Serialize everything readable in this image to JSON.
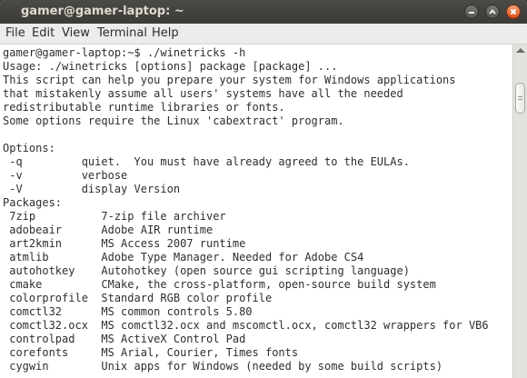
{
  "window": {
    "title": "gamer@gamer-laptop: ~"
  },
  "menu": [
    {
      "label": "File"
    },
    {
      "label": "Edit"
    },
    {
      "label": "View"
    },
    {
      "label": "Terminal"
    },
    {
      "label": "Help"
    }
  ],
  "terminal": {
    "lines": [
      "gamer@gamer-laptop:~$ ./winetricks -h",
      "Usage: ./winetricks [options] package [package] ...",
      "This script can help you prepare your system for Windows applications",
      "that mistakenly assume all users' systems have all the needed",
      "redistributable runtime libraries or fonts.",
      "Some options require the Linux 'cabextract' program.",
      "",
      "Options:",
      " -q         quiet.  You must have already agreed to the EULAs.",
      " -v         verbose",
      " -V         display Version",
      "Packages:",
      " 7zip          7-zip file archiver",
      " adobeair      Adobe AIR runtime",
      " art2kmin      MS Access 2007 runtime",
      " atmlib        Adobe Type Manager. Needed for Adobe CS4",
      " autohotkey    Autohotkey (open source gui scripting language)",
      " cmake         CMake, the cross-platform, open-source build system",
      " colorprofile  Standard RGB color profile",
      " comctl32      MS common controls 5.80",
      " comctl32.ocx  MS comctl32.ocx and mscomctl.ocx, comctl32 wrappers for VB6",
      " controlpad    MS ActiveX Control Pad",
      " corefonts     MS Arial, Courier, Times fonts",
      " cygwin        Unix apps for Windows (needed by some build scripts)"
    ]
  },
  "icons": {
    "minimize": "minimize-icon",
    "maximize": "maximize-icon",
    "close": "close-icon"
  },
  "colors": {
    "titlebar": "#3c3b37",
    "close_button": "#dd4814",
    "terminal_bg": "#ffffff",
    "terminal_fg": "#2e2e2e"
  }
}
